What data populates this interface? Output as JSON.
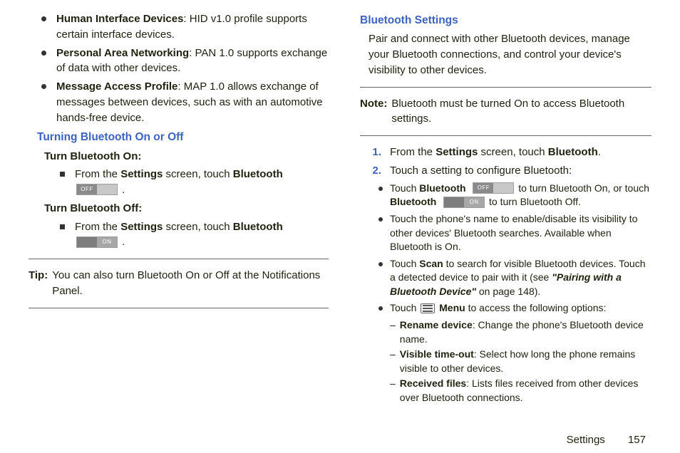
{
  "left": {
    "bullets": [
      {
        "bold": "Human Interface Devices",
        "rest": ": HID v1.0 profile supports certain interface devices."
      },
      {
        "bold": "Personal Area Networking",
        "rest": ": PAN 1.0 supports exchange of data with other devices."
      },
      {
        "bold": "Message Access Profile",
        "rest": ": MAP 1.0 allows exchange of messages between devices, such as with an automotive hands-free device."
      }
    ],
    "heading_turning": "Turning Bluetooth On or Off",
    "heading_on": "Turn Bluetooth On:",
    "step_on_a": "From the ",
    "step_on_settings": "Settings",
    "step_on_b": " screen, touch ",
    "step_on_bt": "Bluetooth",
    "toggle_off_label": "OFF",
    "heading_off": "Turn Bluetooth Off:",
    "step_off_a": "From the ",
    "step_off_settings": "Settings",
    "step_off_b": " screen, touch ",
    "step_off_bt": "Bluetooth",
    "toggle_on_label": "ON",
    "tip_label": "Tip:",
    "tip_text": "You can also turn Bluetooth On or Off at the Notifications Panel."
  },
  "right": {
    "heading_settings": "Bluetooth Settings",
    "intro": "Pair and connect with other Bluetooth devices, manage your Bluetooth connections, and control your device's visibility to other devices.",
    "note_label": "Note:",
    "note_text": "Bluetooth must be turned On to access Bluetooth settings.",
    "step1_num": "1.",
    "step1_a": "From the ",
    "step1_settings": "Settings",
    "step1_b": " screen, touch ",
    "step1_bt": "Bluetooth",
    "step1_period": ".",
    "step2_num": "2.",
    "step2_text": "Touch a setting to configure Bluetooth:",
    "sb1_a": "Touch ",
    "sb1_bt": "Bluetooth",
    "toggle_off_label": "OFF",
    "sb1_b": " to turn Bluetooth On, or touch ",
    "sb1_bt2": "Bluetooth",
    "toggle_on_label": "ON",
    "sb1_c": " to turn Bluetooth Off.",
    "sb2": "Touch the phone's name to enable/disable its visibility to other devices' Bluetooth searches. Available when Bluetooth is On.",
    "sb3_a": "Touch ",
    "sb3_scan": "Scan",
    "sb3_b": " to search for visible Bluetooth devices. Touch a detected device to pair with it (see ",
    "sb3_ref": "\"Pairing with a Bluetooth Device\"",
    "sb3_c": " on page 148).",
    "sb4_a": "Touch ",
    "sb4_menu": "Menu",
    "sb4_b": " to access the following options:",
    "d1_bold": "Rename device",
    "d1_rest": ": Change the phone's Bluetooth device name.",
    "d2_bold": "Visible time-out",
    "d2_rest": ": Select how long the phone remains visible to other devices.",
    "d3_bold": "Received files",
    "d3_rest": ": Lists files received from other devices over Bluetooth connections."
  },
  "footer": {
    "section": "Settings",
    "page": "157"
  }
}
